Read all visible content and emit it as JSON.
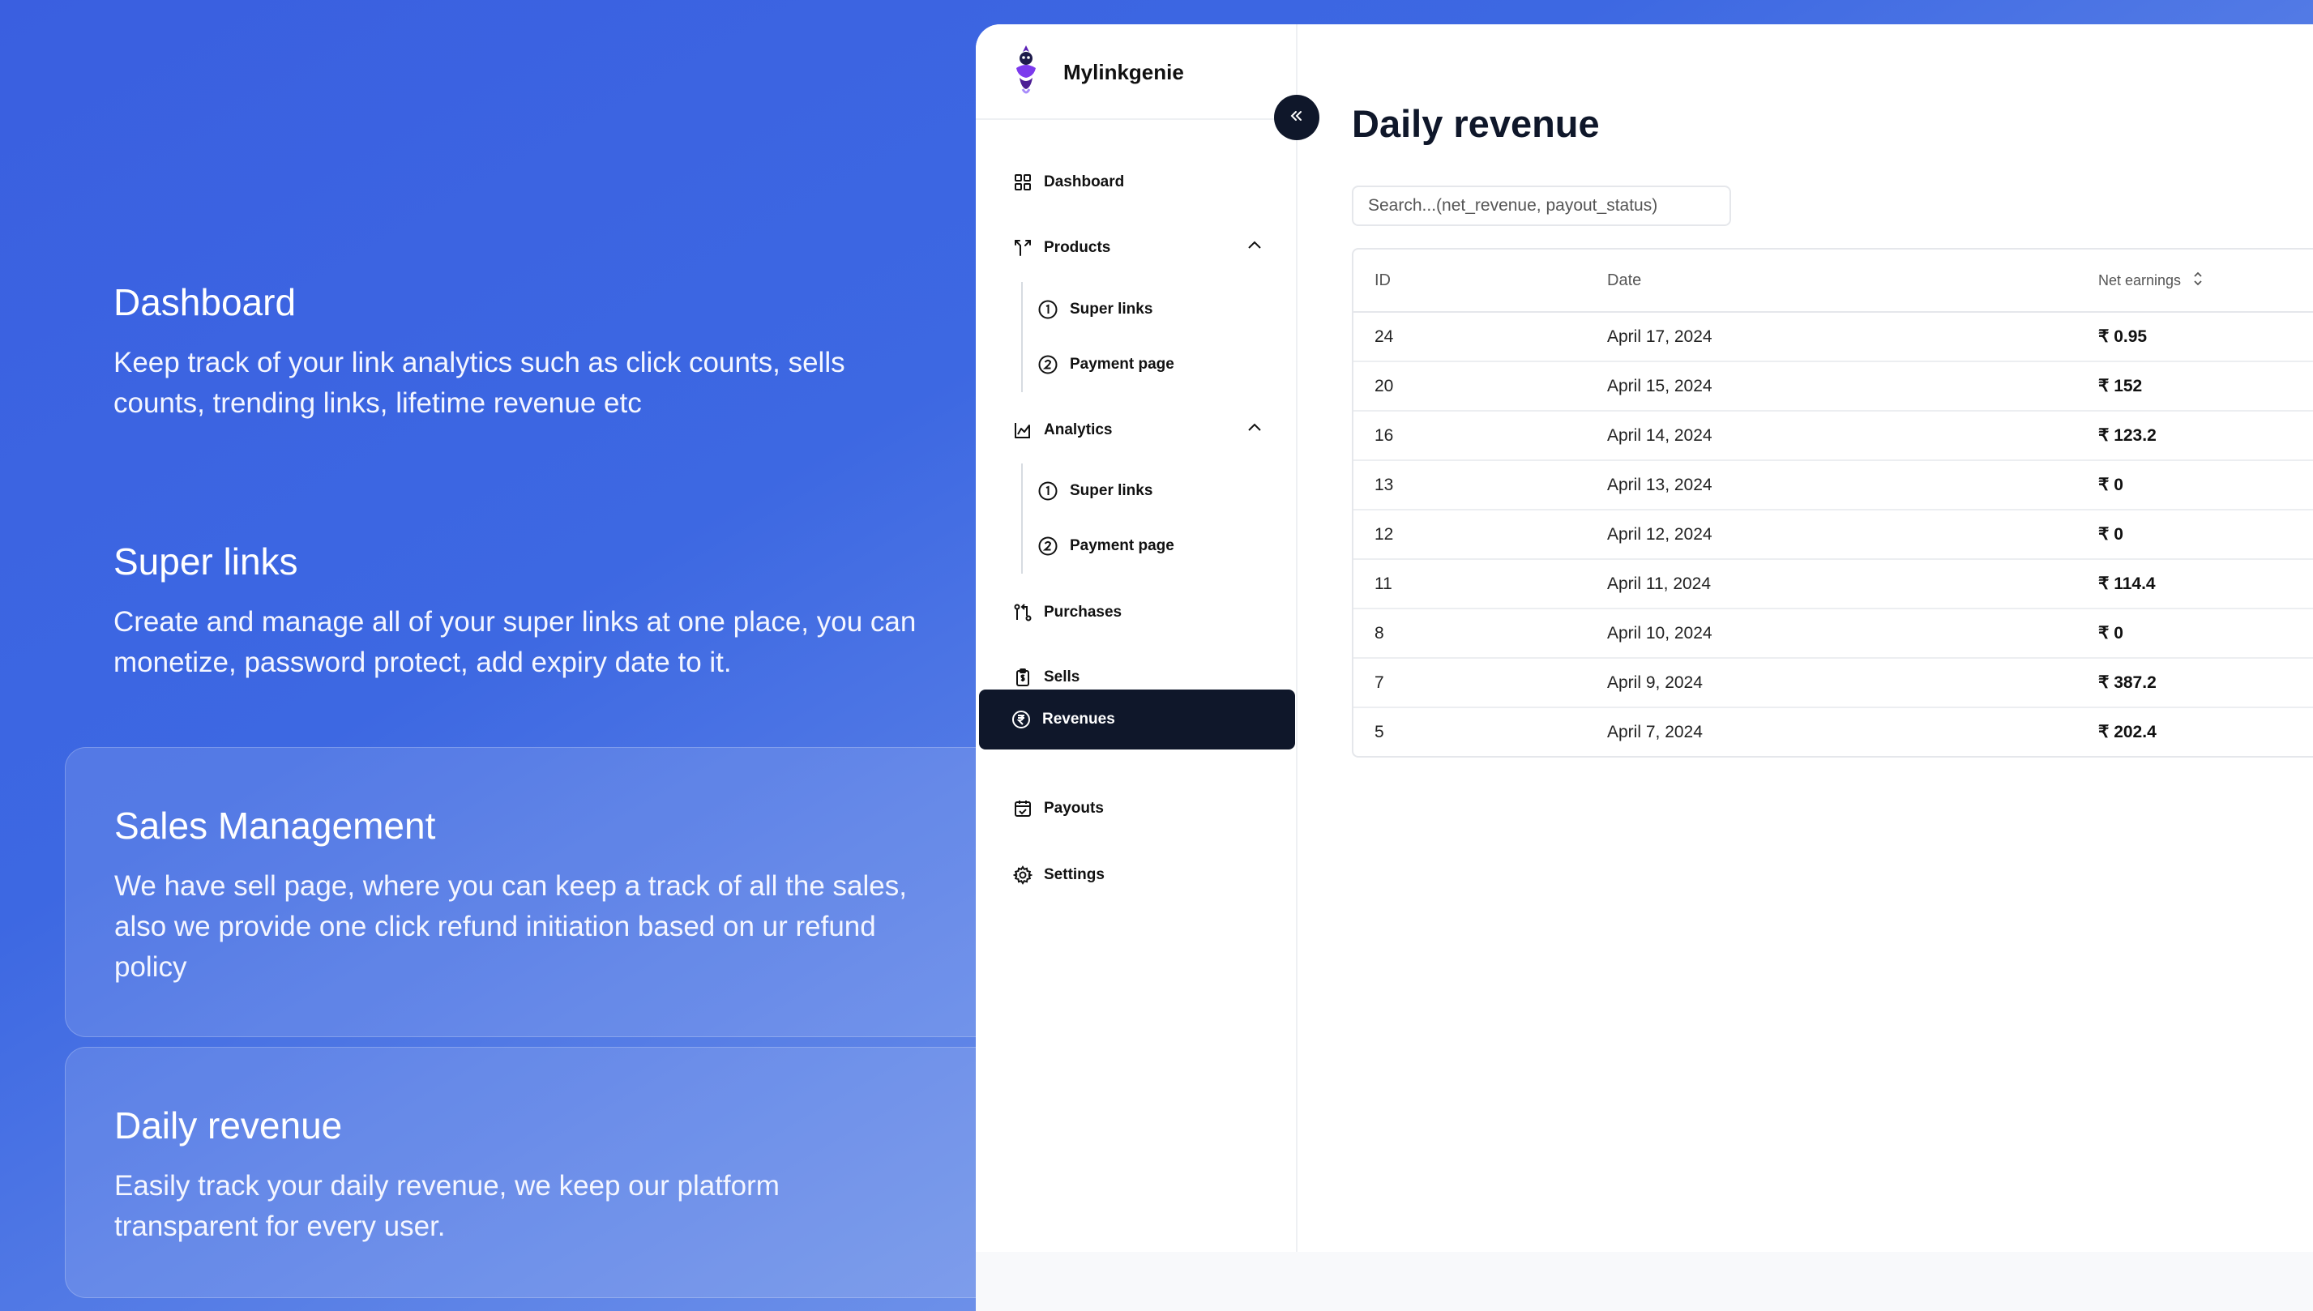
{
  "features": [
    {
      "title": "Dashboard",
      "description": "Keep track of your link analytics such as click counts, sells counts, trending links, lifetime revenue etc"
    },
    {
      "title": "Super links",
      "description": "Create and manage all of your super links at one place, you can monetize, password protect, add expiry date to it."
    },
    {
      "title": "Sales Management",
      "description": "We have sell page, where you can keep a track of all the sales, also we provide one click refund initiation based on ur refund policy"
    },
    {
      "title": "Daily revenue",
      "description": "Easily track your daily revenue, we keep our platform transparent for every user."
    }
  ],
  "app": {
    "brand": "Mylinkgenie",
    "nav": {
      "dashboard": "Dashboard",
      "products": "Products",
      "products_super_links": "Super links",
      "products_payment_page": "Payment page",
      "analytics": "Analytics",
      "analytics_super_links": "Super links",
      "analytics_payment_page": "Payment page",
      "purchases": "Purchases",
      "sells": "Sells",
      "revenues": "Revenues",
      "payouts": "Payouts",
      "settings": "Settings"
    },
    "active_nav": "Revenues",
    "colors": {
      "sidebar_active_bg": "#0f172a",
      "accent_logo": "#6d28d9"
    }
  },
  "main": {
    "title": "Daily revenue",
    "search_placeholder": "Search...(net_revenue, payout_status)",
    "table": {
      "headers": {
        "id": "ID",
        "date": "Date",
        "net": "Net earnings"
      },
      "rows": [
        {
          "id": "24",
          "date": "April 17, 2024",
          "net": "₹ 0.95"
        },
        {
          "id": "20",
          "date": "April 15, 2024",
          "net": "₹ 152"
        },
        {
          "id": "16",
          "date": "April 14, 2024",
          "net": "₹ 123.2"
        },
        {
          "id": "13",
          "date": "April 13, 2024",
          "net": "₹ 0"
        },
        {
          "id": "12",
          "date": "April 12, 2024",
          "net": "₹ 0"
        },
        {
          "id": "11",
          "date": "April 11, 2024",
          "net": "₹ 114.4"
        },
        {
          "id": "8",
          "date": "April 10, 2024",
          "net": "₹ 0"
        },
        {
          "id": "7",
          "date": "April 9, 2024",
          "net": "₹ 387.2"
        },
        {
          "id": "5",
          "date": "April 7, 2024",
          "net": "₹ 202.4"
        }
      ]
    }
  }
}
